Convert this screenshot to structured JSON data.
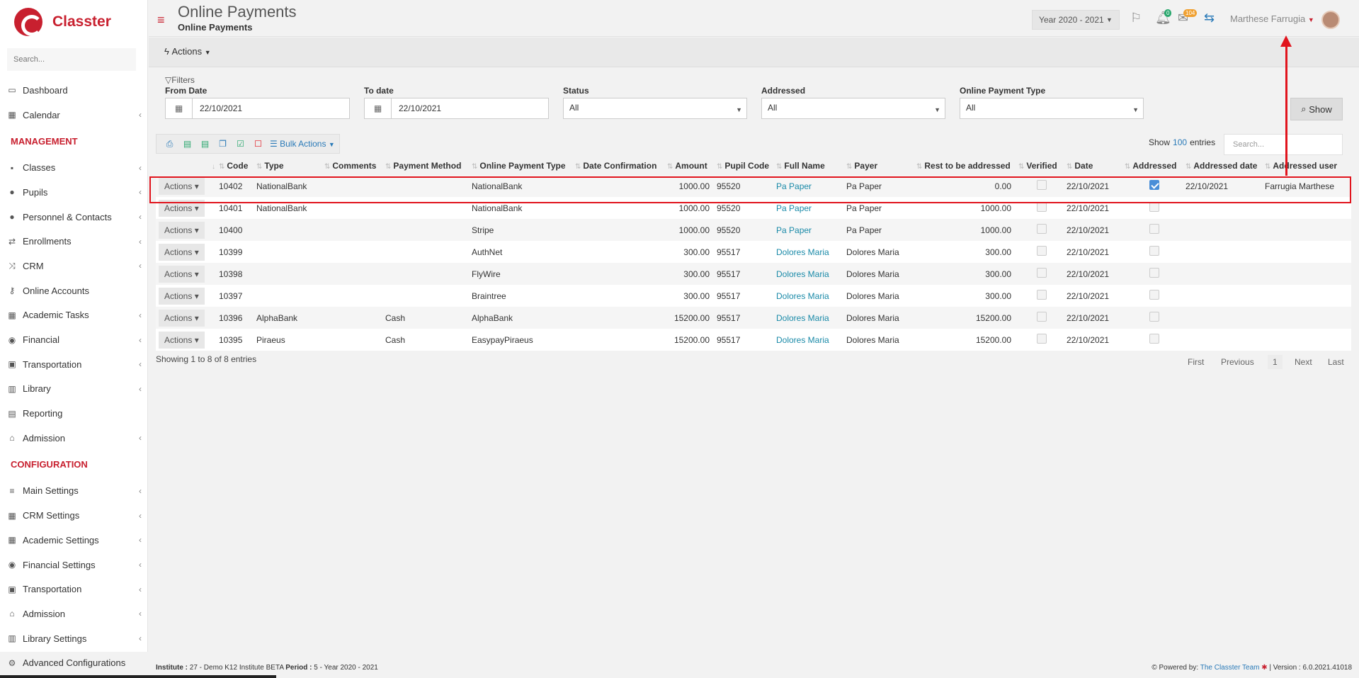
{
  "app": {
    "name": "Classter"
  },
  "sidebar": {
    "search_placeholder": "Search...",
    "items_top": [
      {
        "label": "Dashboard",
        "icon": "laptop-icon",
        "glyph": "▭",
        "chev": false
      },
      {
        "label": "Calendar",
        "icon": "calendar-icon",
        "glyph": "▦",
        "chev": true
      }
    ],
    "section_management": "MANAGEMENT",
    "items_management": [
      {
        "label": "Classes",
        "icon": "classes-icon",
        "glyph": "▪",
        "chev": true
      },
      {
        "label": "Pupils",
        "icon": "users-icon",
        "glyph": "●",
        "chev": true
      },
      {
        "label": "Personnel & Contacts",
        "icon": "contacts-icon",
        "glyph": "●",
        "chev": true
      },
      {
        "label": "Enrollments",
        "icon": "exchange-icon",
        "glyph": "⇄",
        "chev": true
      },
      {
        "label": "CRM",
        "icon": "random-icon",
        "glyph": "⤨",
        "chev": true
      },
      {
        "label": "Online Accounts",
        "icon": "key-icon",
        "glyph": "⚷",
        "chev": false
      },
      {
        "label": "Academic Tasks",
        "icon": "th-large-icon",
        "glyph": "▦",
        "chev": true
      },
      {
        "label": "Financial",
        "icon": "coins-icon",
        "glyph": "◉",
        "chev": true
      },
      {
        "label": "Transportation",
        "icon": "bus-icon",
        "glyph": "▣",
        "chev": true
      },
      {
        "label": "Library",
        "icon": "books-icon",
        "glyph": "▥",
        "chev": true
      },
      {
        "label": "Reporting",
        "icon": "report-icon",
        "glyph": "▤",
        "chev": false
      },
      {
        "label": "Admission",
        "icon": "institution-icon",
        "glyph": "⌂",
        "chev": true
      }
    ],
    "section_configuration": "CONFIGURATION",
    "items_configuration": [
      {
        "label": "Main Settings",
        "icon": "sliders-icon",
        "glyph": "≡",
        "chev": true
      },
      {
        "label": "CRM Settings",
        "icon": "crm-settings-icon",
        "glyph": "▦",
        "chev": true
      },
      {
        "label": "Academic Settings",
        "icon": "th-large-icon",
        "glyph": "▦",
        "chev": true
      },
      {
        "label": "Financial Settings",
        "icon": "coins-icon",
        "glyph": "◉",
        "chev": true
      },
      {
        "label": "Transportation",
        "icon": "bus-icon",
        "glyph": "▣",
        "chev": true
      },
      {
        "label": "Admission",
        "icon": "institution-icon",
        "glyph": "⌂",
        "chev": true
      },
      {
        "label": "Library Settings",
        "icon": "books-icon",
        "glyph": "▥",
        "chev": true
      },
      {
        "label": "Advanced Configurations",
        "icon": "gears-icon",
        "glyph": "⚙",
        "chev": false
      }
    ]
  },
  "header": {
    "title": "Online Payments",
    "subtitle": "Online Payments",
    "year": "Year 2020 - 2021",
    "notif_count": "0",
    "message_count": "104",
    "user": "Marthese Farrugia"
  },
  "actions_label": "Actions",
  "filters": {
    "label": "Filters",
    "from_date_label": "From Date",
    "from_date": "22/10/2021",
    "to_date_label": "To date",
    "to_date": "22/10/2021",
    "status_label": "Status",
    "status": "All",
    "addressed_label": "Addressed",
    "addressed": "All",
    "type_label": "Online Payment Type",
    "type": "All",
    "show_button": "Show"
  },
  "table_tools": {
    "bulk_actions": "Bulk Actions",
    "show_label": "Show",
    "entries_count": "100",
    "entries_label": "entries",
    "search_placeholder": "Search..."
  },
  "table": {
    "columns": [
      "",
      "Code",
      "Type",
      "Comments",
      "Payment Method",
      "Online Payment Type",
      "Date Confirmation",
      "Amount",
      "Pupil Code",
      "Full Name",
      "Payer",
      "Rest to be addressed",
      "Verified",
      "Date",
      "Addressed",
      "Addressed date",
      "Addressed user"
    ],
    "rows": [
      {
        "actions": "Actions",
        "code": "10402",
        "type": "NationalBank",
        "comments": "",
        "method": "",
        "online_type": "NationalBank",
        "date_conf": "",
        "amount": "1000.00",
        "pupil_code": "95520",
        "full_name": "Pa Paper",
        "payer": "Pa Paper",
        "rest": "0.00",
        "verified": false,
        "date": "22/10/2021",
        "addressed": true,
        "addressed_date": "22/10/2021",
        "addressed_user": "Farrugia Marthese"
      },
      {
        "actions": "Actions",
        "code": "10401",
        "type": "NationalBank",
        "comments": "",
        "method": "",
        "online_type": "NationalBank",
        "date_conf": "",
        "amount": "1000.00",
        "pupil_code": "95520",
        "full_name": "Pa Paper",
        "payer": "Pa Paper",
        "rest": "1000.00",
        "verified": false,
        "date": "22/10/2021",
        "addressed": false,
        "addressed_date": "",
        "addressed_user": ""
      },
      {
        "actions": "Actions",
        "code": "10400",
        "type": "",
        "comments": "",
        "method": "",
        "online_type": "Stripe",
        "date_conf": "",
        "amount": "1000.00",
        "pupil_code": "95520",
        "full_name": "Pa Paper",
        "payer": "Pa Paper",
        "rest": "1000.00",
        "verified": false,
        "date": "22/10/2021",
        "addressed": false,
        "addressed_date": "",
        "addressed_user": ""
      },
      {
        "actions": "Actions",
        "code": "10399",
        "type": "",
        "comments": "",
        "method": "",
        "online_type": "AuthNet",
        "date_conf": "",
        "amount": "300.00",
        "pupil_code": "95517",
        "full_name": "Dolores Maria",
        "payer": "Dolores Maria",
        "rest": "300.00",
        "verified": false,
        "date": "22/10/2021",
        "addressed": false,
        "addressed_date": "",
        "addressed_user": ""
      },
      {
        "actions": "Actions",
        "code": "10398",
        "type": "",
        "comments": "",
        "method": "",
        "online_type": "FlyWire",
        "date_conf": "",
        "amount": "300.00",
        "pupil_code": "95517",
        "full_name": "Dolores Maria",
        "payer": "Dolores Maria",
        "rest": "300.00",
        "verified": false,
        "date": "22/10/2021",
        "addressed": false,
        "addressed_date": "",
        "addressed_user": ""
      },
      {
        "actions": "Actions",
        "code": "10397",
        "type": "",
        "comments": "",
        "method": "",
        "online_type": "Braintree",
        "date_conf": "",
        "amount": "300.00",
        "pupil_code": "95517",
        "full_name": "Dolores Maria",
        "payer": "Dolores Maria",
        "rest": "300.00",
        "verified": false,
        "date": "22/10/2021",
        "addressed": false,
        "addressed_date": "",
        "addressed_user": ""
      },
      {
        "actions": "Actions",
        "code": "10396",
        "type": "AlphaBank",
        "comments": "",
        "method": "Cash",
        "online_type": "AlphaBank",
        "date_conf": "",
        "amount": "15200.00",
        "pupil_code": "95517",
        "full_name": "Dolores Maria",
        "payer": "Dolores Maria",
        "rest": "15200.00",
        "verified": false,
        "date": "22/10/2021",
        "addressed": false,
        "addressed_date": "",
        "addressed_user": ""
      },
      {
        "actions": "Actions",
        "code": "10395",
        "type": "Piraeus",
        "comments": "",
        "method": "Cash",
        "online_type": "EasypayPiraeus",
        "date_conf": "",
        "amount": "15200.00",
        "pupil_code": "95517",
        "full_name": "Dolores Maria",
        "payer": "Dolores Maria",
        "rest": "15200.00",
        "verified": false,
        "date": "22/10/2021",
        "addressed": false,
        "addressed_date": "",
        "addressed_user": ""
      }
    ]
  },
  "pagination": {
    "info": "Showing 1 to 8 of 8 entries",
    "first": "First",
    "previous": "Previous",
    "current": "1",
    "next": "Next",
    "last": "Last"
  },
  "footer": {
    "institute_label": "Institute :",
    "institute": "27 - Demo K12 Institute BETA",
    "period_label": "Period :",
    "period": "5 - Year 2020 - 2021",
    "powered_by": "Powered by:",
    "team": "The Classter Team",
    "version": "| Version : 6.0.2021.41018"
  },
  "colors": {
    "brand": "#c8202f",
    "link": "#1a8aa8",
    "highlight": "#e1141d"
  }
}
